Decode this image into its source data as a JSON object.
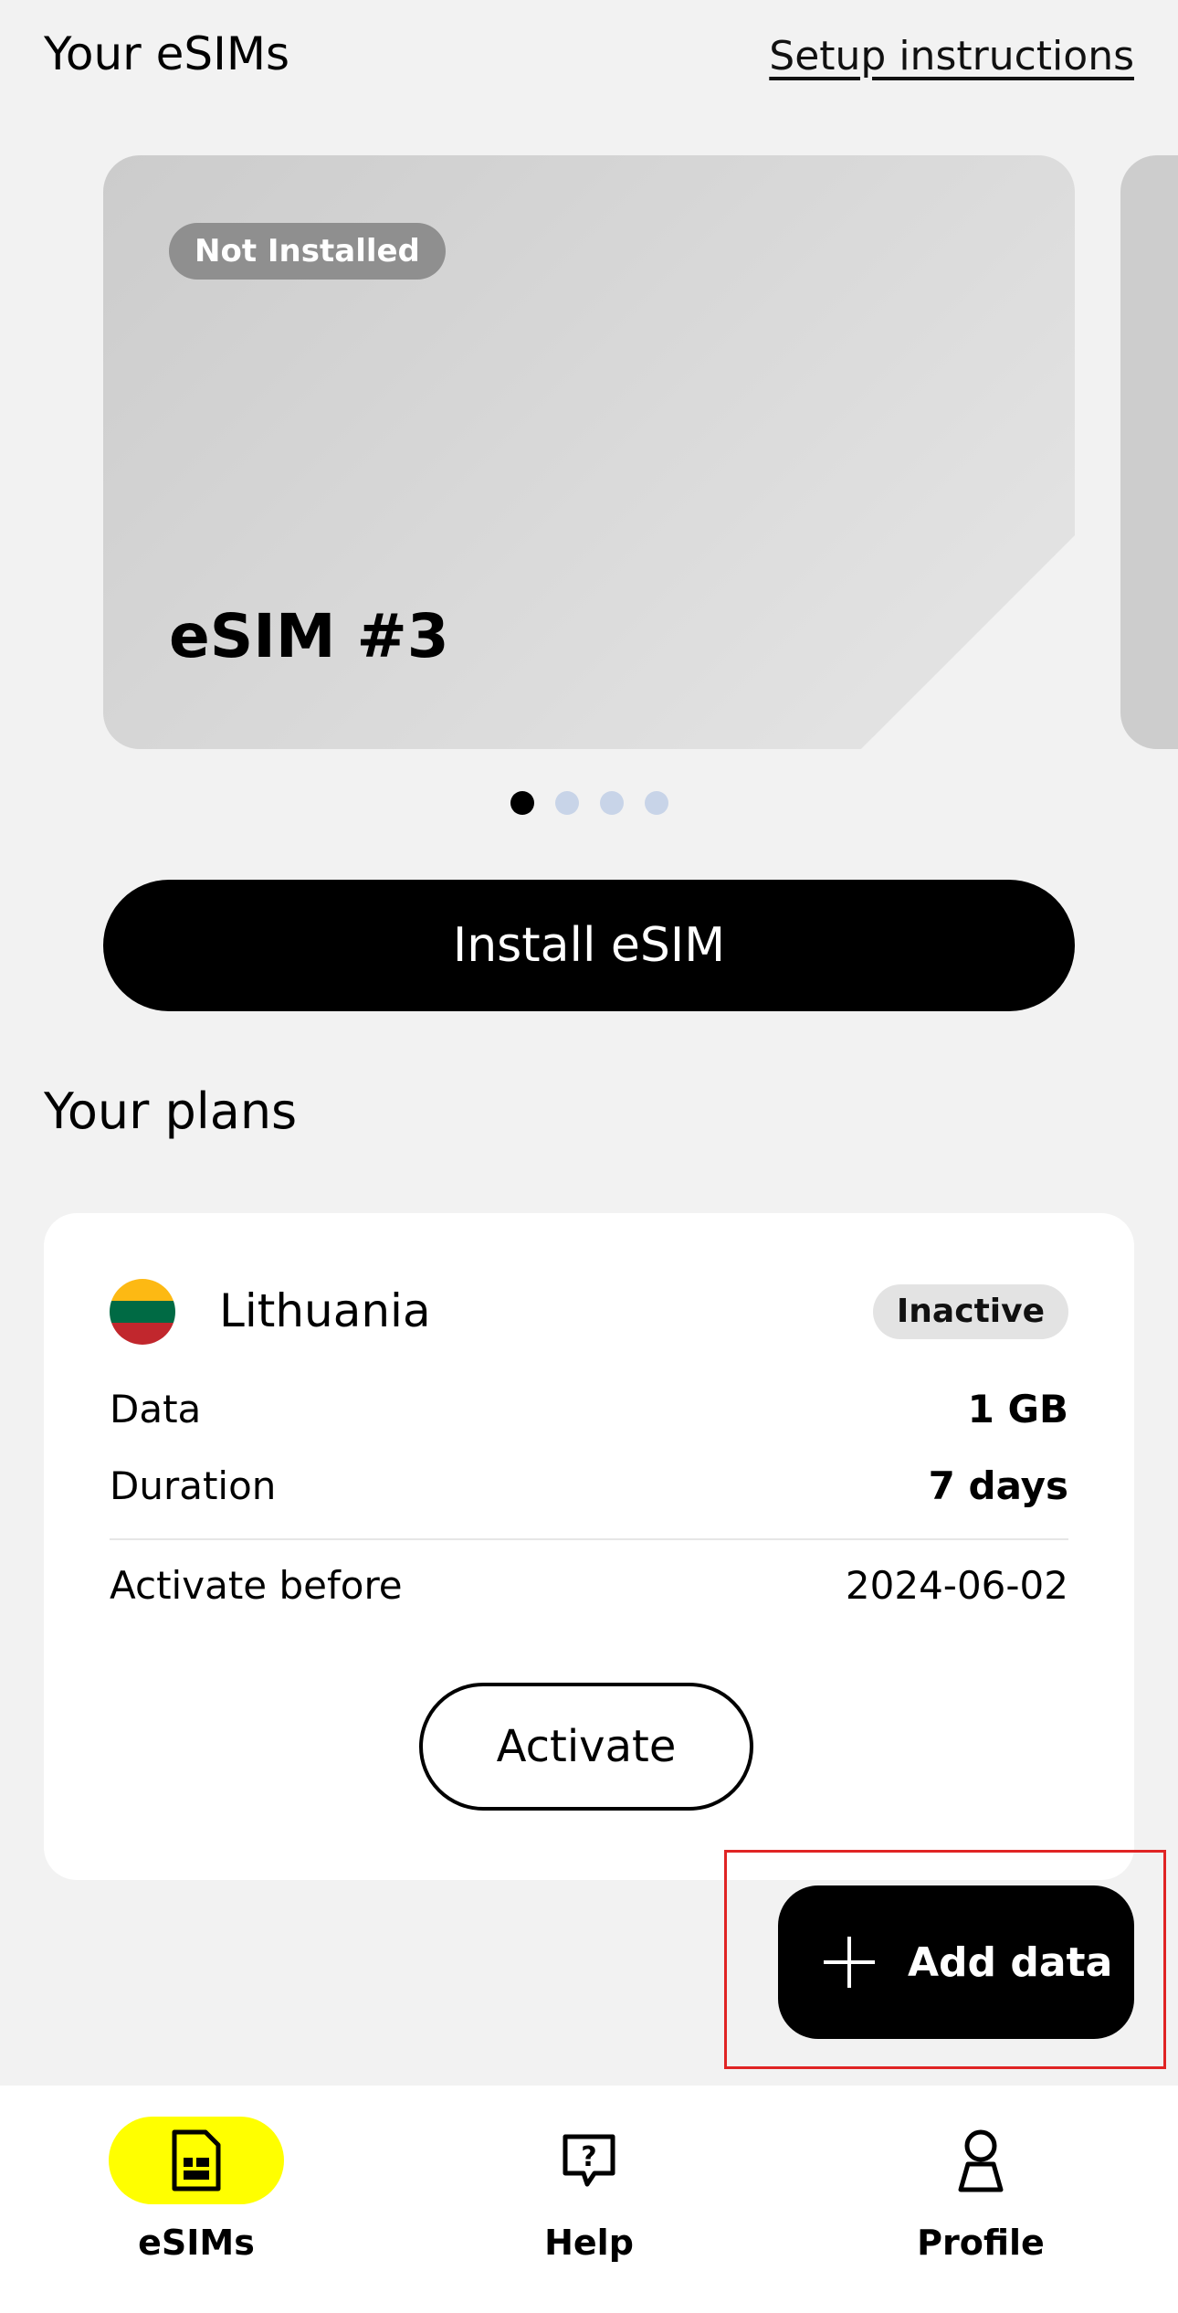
{
  "header": {
    "title": "Your eSIMs",
    "setup_link": "Setup instructions"
  },
  "carousel": {
    "card": {
      "status": "Not Installed",
      "name": "eSIM #3"
    },
    "page_count": 4,
    "active_page": 1
  },
  "install_button": "Install eSIM",
  "plans": {
    "title": "Your plans",
    "items": [
      {
        "country": "Lithuania",
        "status": "Inactive",
        "data_label": "Data",
        "data_value": "1 GB",
        "duration_label": "Duration",
        "duration_value": "7 days",
        "activate_before_label": "Activate before",
        "activate_before_value": "2024-06-02",
        "activate_button": "Activate",
        "flag_colors": [
          "#FDB913",
          "#006A44",
          "#C1272D"
        ]
      }
    ]
  },
  "add_data_button": "Add data",
  "tabbar": {
    "items": [
      {
        "label": "eSIMs",
        "icon": "sim-card-icon",
        "active": true
      },
      {
        "label": "Help",
        "icon": "help-bubble-icon",
        "active": false
      },
      {
        "label": "Profile",
        "icon": "person-icon",
        "active": false
      }
    ]
  },
  "colors": {
    "accent": "#FFFF00",
    "background": "#F2F2F2",
    "highlight": "#E02424"
  }
}
